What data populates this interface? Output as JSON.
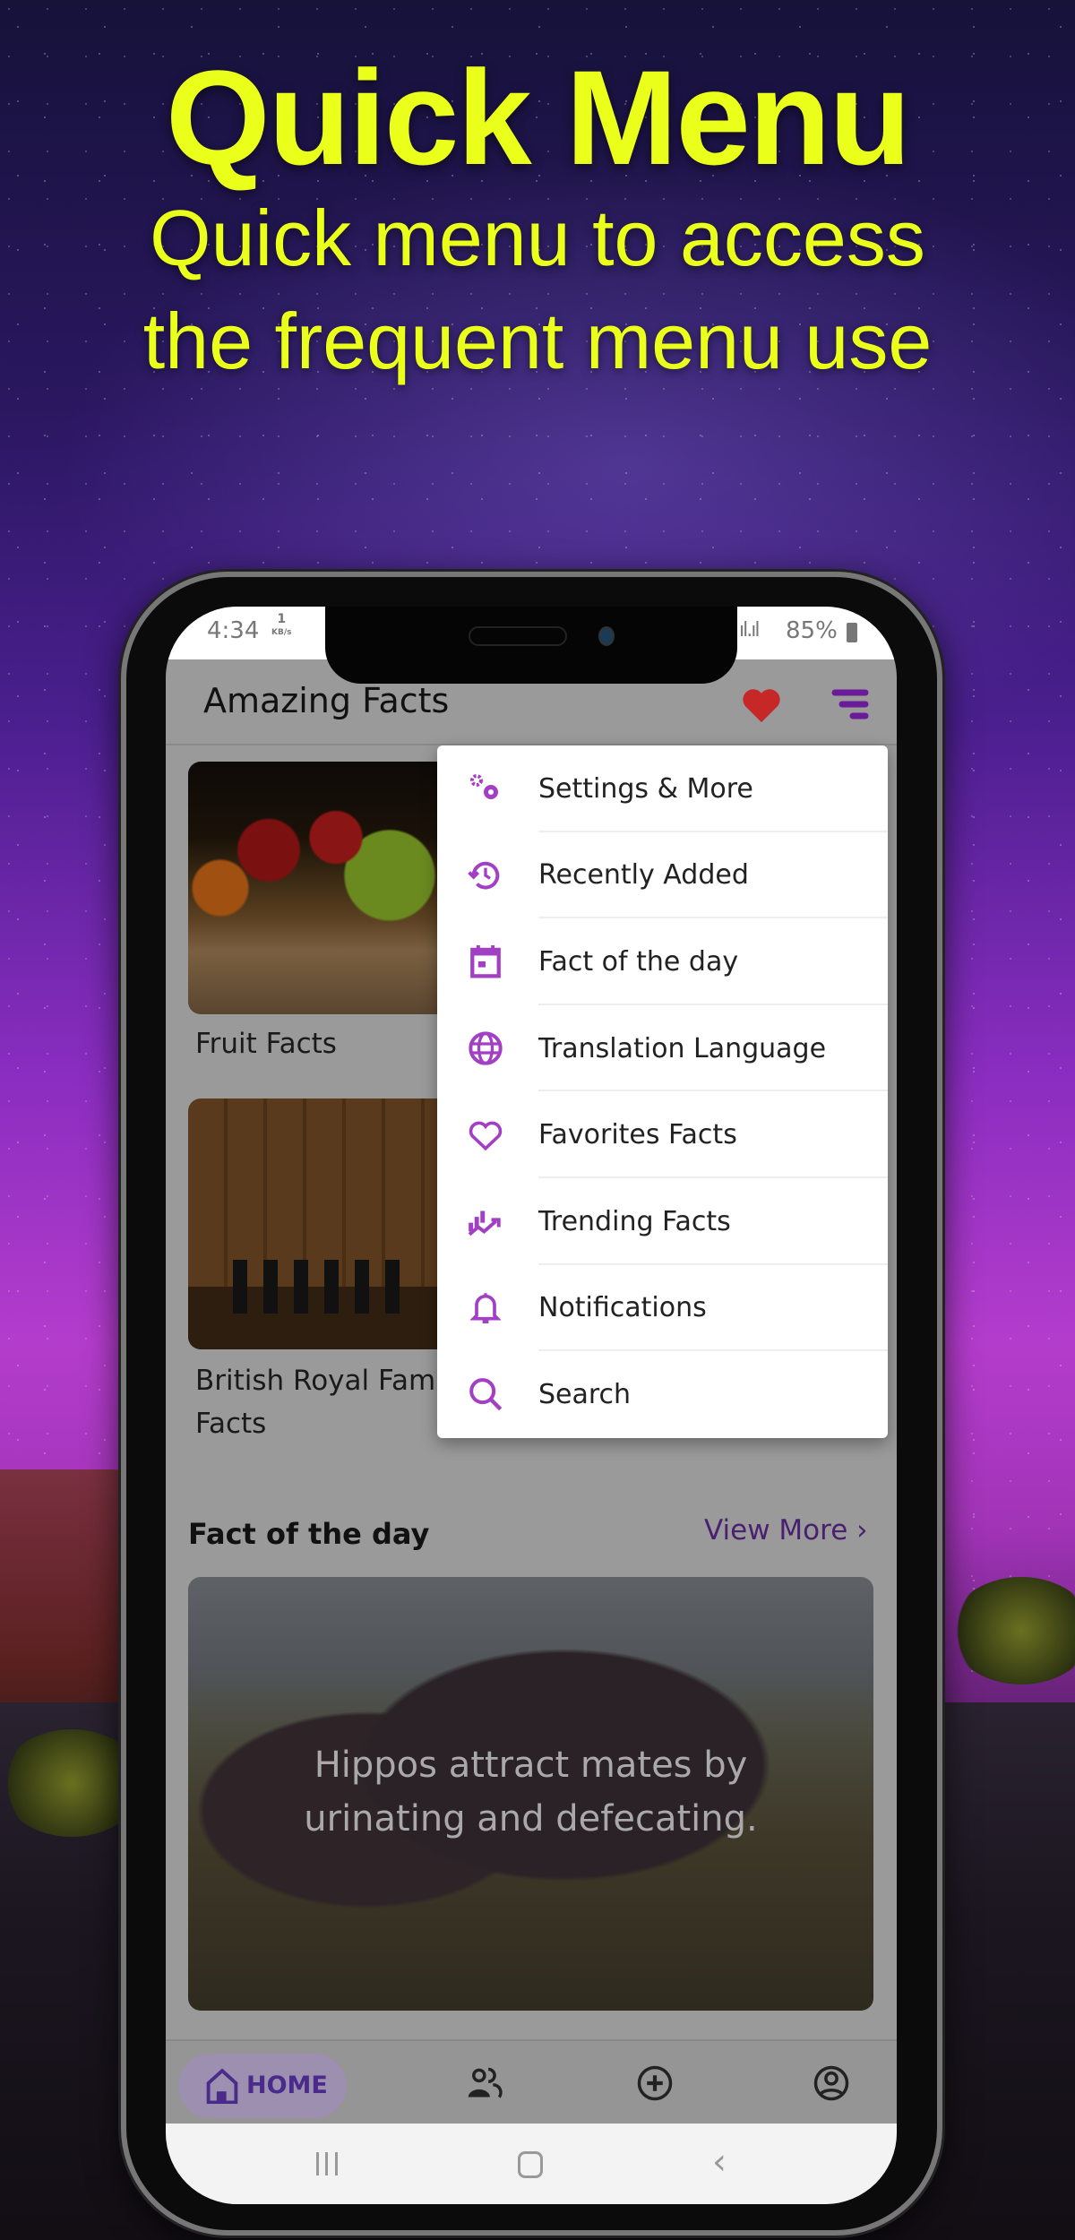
{
  "hero": {
    "title": "Quick Menu",
    "subtitle_lines": [
      "Quick menu to access",
      "the frequent menu use"
    ]
  },
  "status_bar": {
    "time": "4:34",
    "net_speed": "1",
    "net_unit": "KB/s",
    "battery": "85%"
  },
  "app_bar": {
    "title": "Amazing Facts",
    "icons": [
      "heart-icon",
      "filter-menu-icon"
    ]
  },
  "colors": {
    "accent": "#9c27b0",
    "title_yellow": "#eaff1a",
    "heart": "#c62828",
    "home_pill": "#4a2a8a"
  },
  "categories": [
    {
      "label_lines": [
        "Fruit Facts"
      ]
    },
    {
      "label_lines": [
        "British Royal Fam",
        "Facts"
      ]
    }
  ],
  "quick_menu": {
    "items": [
      {
        "label": "Settings & More",
        "icon": "settings-gears-icon"
      },
      {
        "label": "Recently Added",
        "icon": "history-icon"
      },
      {
        "label": "Fact of the day",
        "icon": "calendar-icon"
      },
      {
        "label": "Translation Language",
        "icon": "globe-icon"
      },
      {
        "label": "Favorites Facts",
        "icon": "heart-outline-icon"
      },
      {
        "label": "Trending Facts",
        "icon": "trending-icon"
      },
      {
        "label": "Notifications",
        "icon": "bell-icon"
      },
      {
        "label": "Search",
        "icon": "search-icon"
      }
    ]
  },
  "fact_of_day": {
    "heading": "Fact of the day",
    "view_more": "View More",
    "chevron": "›",
    "text": "Hippos attract mates by urinating and defecating."
  },
  "bottom_nav": {
    "home_label": "HOME",
    "items": [
      "home-icon",
      "community-icon",
      "add-circle-icon",
      "account-icon"
    ]
  }
}
